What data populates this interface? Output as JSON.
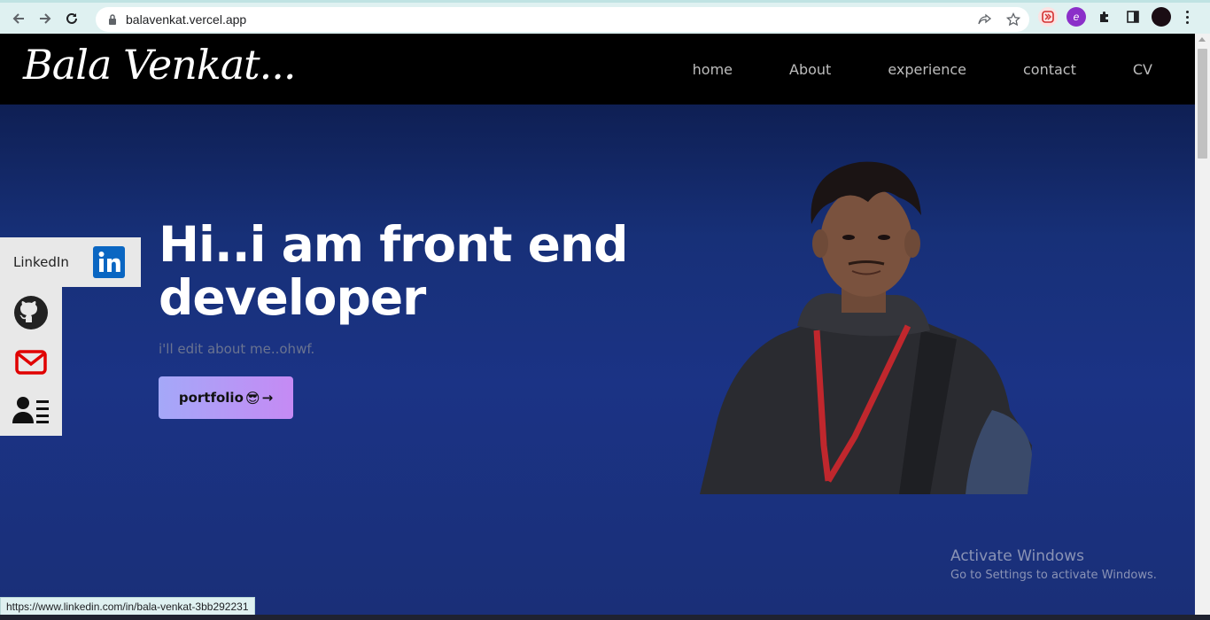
{
  "browser": {
    "url": "balavenkat.vercel.app",
    "status_url": "https://www.linkedin.com/in/bala-venkat-3bb292231"
  },
  "site": {
    "logo": "Bala Venkat...",
    "nav": [
      "home",
      "About",
      "experience",
      "contact",
      "CV"
    ]
  },
  "hero": {
    "title": "Hi..i am front end developer",
    "subtitle": "i'll edit about me..ohwf.",
    "cta_label": "portfolio",
    "cta_emoji": "😎",
    "cta_arrow": "→"
  },
  "social": {
    "linkedin_label": "LinkedIn",
    "items": [
      "linkedin-icon",
      "github-icon",
      "mail-icon",
      "contact-card-icon"
    ],
    "colors": {
      "linkedin": "#0a66c2",
      "mail": "#e00000"
    }
  },
  "watermark": {
    "title": "Activate Windows",
    "subtitle": "Go to Settings to activate Windows."
  },
  "colors": {
    "navbar": "#000000",
    "background": "#1b3385",
    "cta_gradient_start": "#a4a8f8",
    "cta_gradient_end": "#c58af4"
  }
}
